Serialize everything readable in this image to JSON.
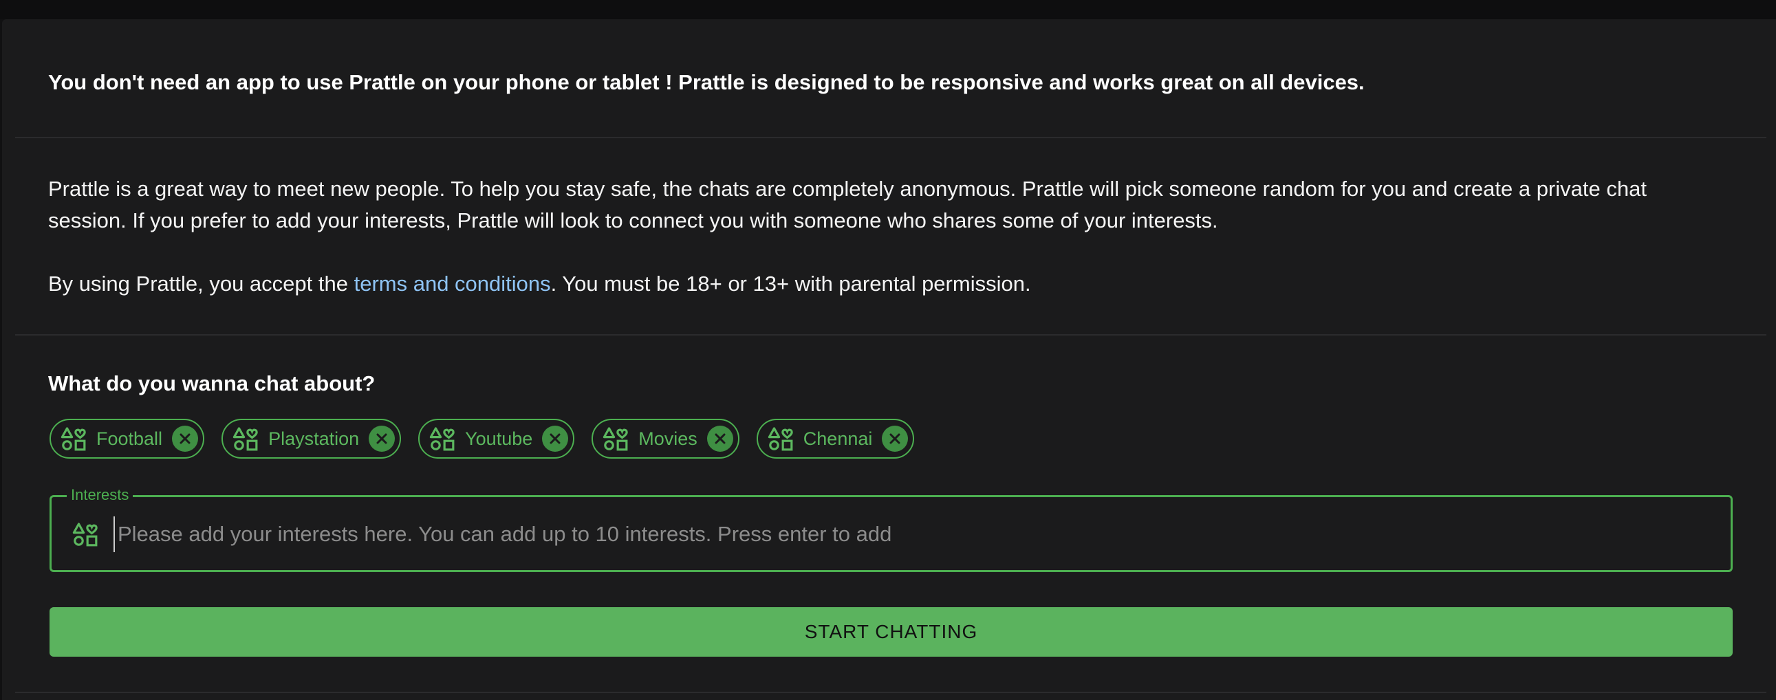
{
  "notice": "You don't need an app to use Prattle on your phone or tablet ! Prattle is designed to be responsive and works great on all devices.",
  "intro": "Prattle is a great way to meet new people. To help you stay safe, the chats are completely anonymous. Prattle will pick someone random for you and create a private chat session. If you prefer to add your interests, Prattle will look to connect you with someone who shares some of your interests.",
  "terms": {
    "prefix": "By using Prattle, you accept the ",
    "link": "terms and conditions",
    "suffix": ". You must be 18+ or 13+ with parental permission."
  },
  "interests_section": {
    "question": "What do you wanna chat about?",
    "chips": [
      "Football",
      "Playstation",
      "Youtube",
      "Movies",
      "Chennai"
    ],
    "chip_icon": "interests-icon",
    "remove_icon": "close-circle-icon",
    "field_label": "Interests",
    "field_placeholder": "Please add your interests here. You can add up to 10 interests. Press enter to add",
    "field_value": ""
  },
  "start_button": "START CHATTING",
  "colors": {
    "accent": "#4caf50",
    "button": "#5bb35e",
    "link": "#8fc4f5",
    "background": "#1b1b1c"
  }
}
